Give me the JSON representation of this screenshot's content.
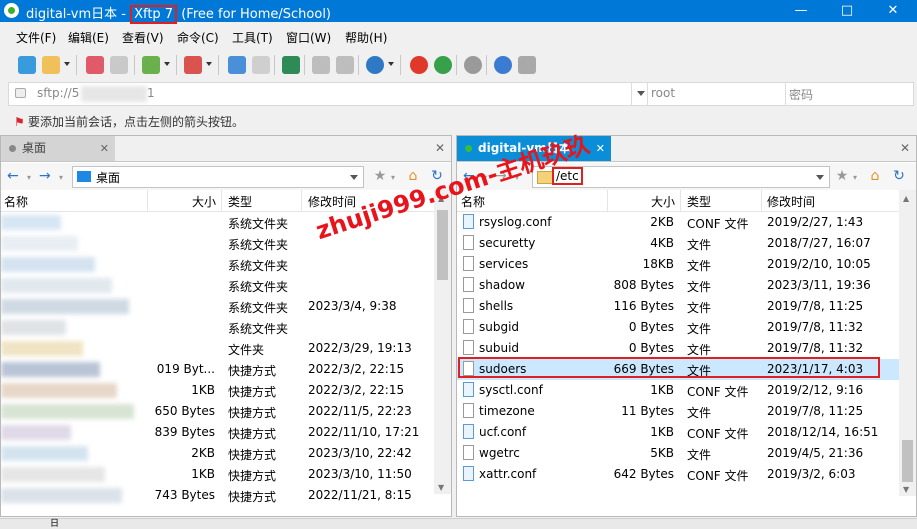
{
  "window": {
    "title_prefix": "digital-vm日本 - ",
    "title_app": "Xftp 7",
    "title_suffix": " (Free for Home/School)",
    "minimize_icon": "minimize-icon",
    "maximize_icon": "maximize-icon",
    "close_icon": "close-icon"
  },
  "menu": [
    "文件(F)",
    "编辑(E)",
    "查看(V)",
    "命令(C)",
    "工具(T)",
    "窗口(W)",
    "帮助(H)"
  ],
  "address": {
    "host": "sftp://5",
    "tail": "1",
    "user_placeholder": "root",
    "password_placeholder": "密码"
  },
  "hint": "要添加当前会话，点击左侧的箭头按钮。",
  "left_pane": {
    "tab_label": "桌面",
    "path": "桌面",
    "columns": [
      "名称",
      "大小",
      "类型",
      "修改时间"
    ],
    "rows": [
      {
        "size": "",
        "type": "系统文件夹",
        "modified": ""
      },
      {
        "size": "",
        "type": "系统文件夹",
        "modified": ""
      },
      {
        "size": "",
        "type": "系统文件夹",
        "modified": ""
      },
      {
        "size": "",
        "type": "系统文件夹",
        "modified": ""
      },
      {
        "size": "",
        "type": "系统文件夹",
        "modified": "2023/3/4, 9:38"
      },
      {
        "size": "",
        "type": "系统文件夹",
        "modified": ""
      },
      {
        "size": "",
        "type": "文件夹",
        "modified": "2022/3/29, 19:13"
      },
      {
        "size": "019 Byt...",
        "type": "快捷方式",
        "modified": "2022/3/2, 22:15"
      },
      {
        "size": "1KB",
        "type": "快捷方式",
        "modified": "2022/3/2, 22:15"
      },
      {
        "size": "650 Bytes",
        "type": "快捷方式",
        "modified": "2022/11/5, 22:23"
      },
      {
        "size": "839 Bytes",
        "type": "快捷方式",
        "modified": "2022/11/10, 17:21"
      },
      {
        "size": "2KB",
        "type": "快捷方式",
        "modified": "2023/3/10, 22:42"
      },
      {
        "size": "1KB",
        "type": "快捷方式",
        "modified": "2023/3/10, 11:50"
      },
      {
        "size": "743 Bytes",
        "type": "快捷方式",
        "modified": "2022/11/21, 8:15"
      }
    ]
  },
  "right_pane": {
    "tab_label": "digital-vm日本",
    "path": "/etc",
    "columns": [
      "名称",
      "大小",
      "类型",
      "修改时间"
    ],
    "rows": [
      {
        "name": "rsyslog.conf",
        "size": "2KB",
        "type": "CONF 文件",
        "modified": "2019/2/27, 1:43",
        "conf": true
      },
      {
        "name": "securetty",
        "size": "4KB",
        "type": "文件",
        "modified": "2018/7/27, 16:07",
        "conf": false
      },
      {
        "name": "services",
        "size": "18KB",
        "type": "文件",
        "modified": "2019/2/10, 10:05",
        "conf": false
      },
      {
        "name": "shadow",
        "size": "808 Bytes",
        "type": "文件",
        "modified": "2023/3/11, 19:36",
        "conf": false
      },
      {
        "name": "shells",
        "size": "116 Bytes",
        "type": "文件",
        "modified": "2019/7/8, 11:25",
        "conf": false
      },
      {
        "name": "subgid",
        "size": "0 Bytes",
        "type": "文件",
        "modified": "2019/7/8, 11:32",
        "conf": false
      },
      {
        "name": "subuid",
        "size": "0 Bytes",
        "type": "文件",
        "modified": "2019/7/8, 11:32",
        "conf": false
      },
      {
        "name": "sudoers",
        "size": "669 Bytes",
        "type": "文件",
        "modified": "2023/1/17, 4:03",
        "conf": false,
        "selected": true
      },
      {
        "name": "sysctl.conf",
        "size": "1KB",
        "type": "CONF 文件",
        "modified": "2019/2/12, 9:16",
        "conf": true
      },
      {
        "name": "timezone",
        "size": "11 Bytes",
        "type": "文件",
        "modified": "2019/7/8, 11:25",
        "conf": false
      },
      {
        "name": "ucf.conf",
        "size": "1KB",
        "type": "CONF 文件",
        "modified": "2018/12/14, 16:51",
        "conf": true
      },
      {
        "name": "wgetrc",
        "size": "5KB",
        "type": "文件",
        "modified": "2019/4/5, 21:36",
        "conf": false
      },
      {
        "name": "xattr.conf",
        "size": "642 Bytes",
        "type": "CONF 文件",
        "modified": "2019/3/2, 6:03",
        "conf": true
      }
    ]
  },
  "watermark": "zhuji999.com-主机玖玖",
  "status": "日"
}
